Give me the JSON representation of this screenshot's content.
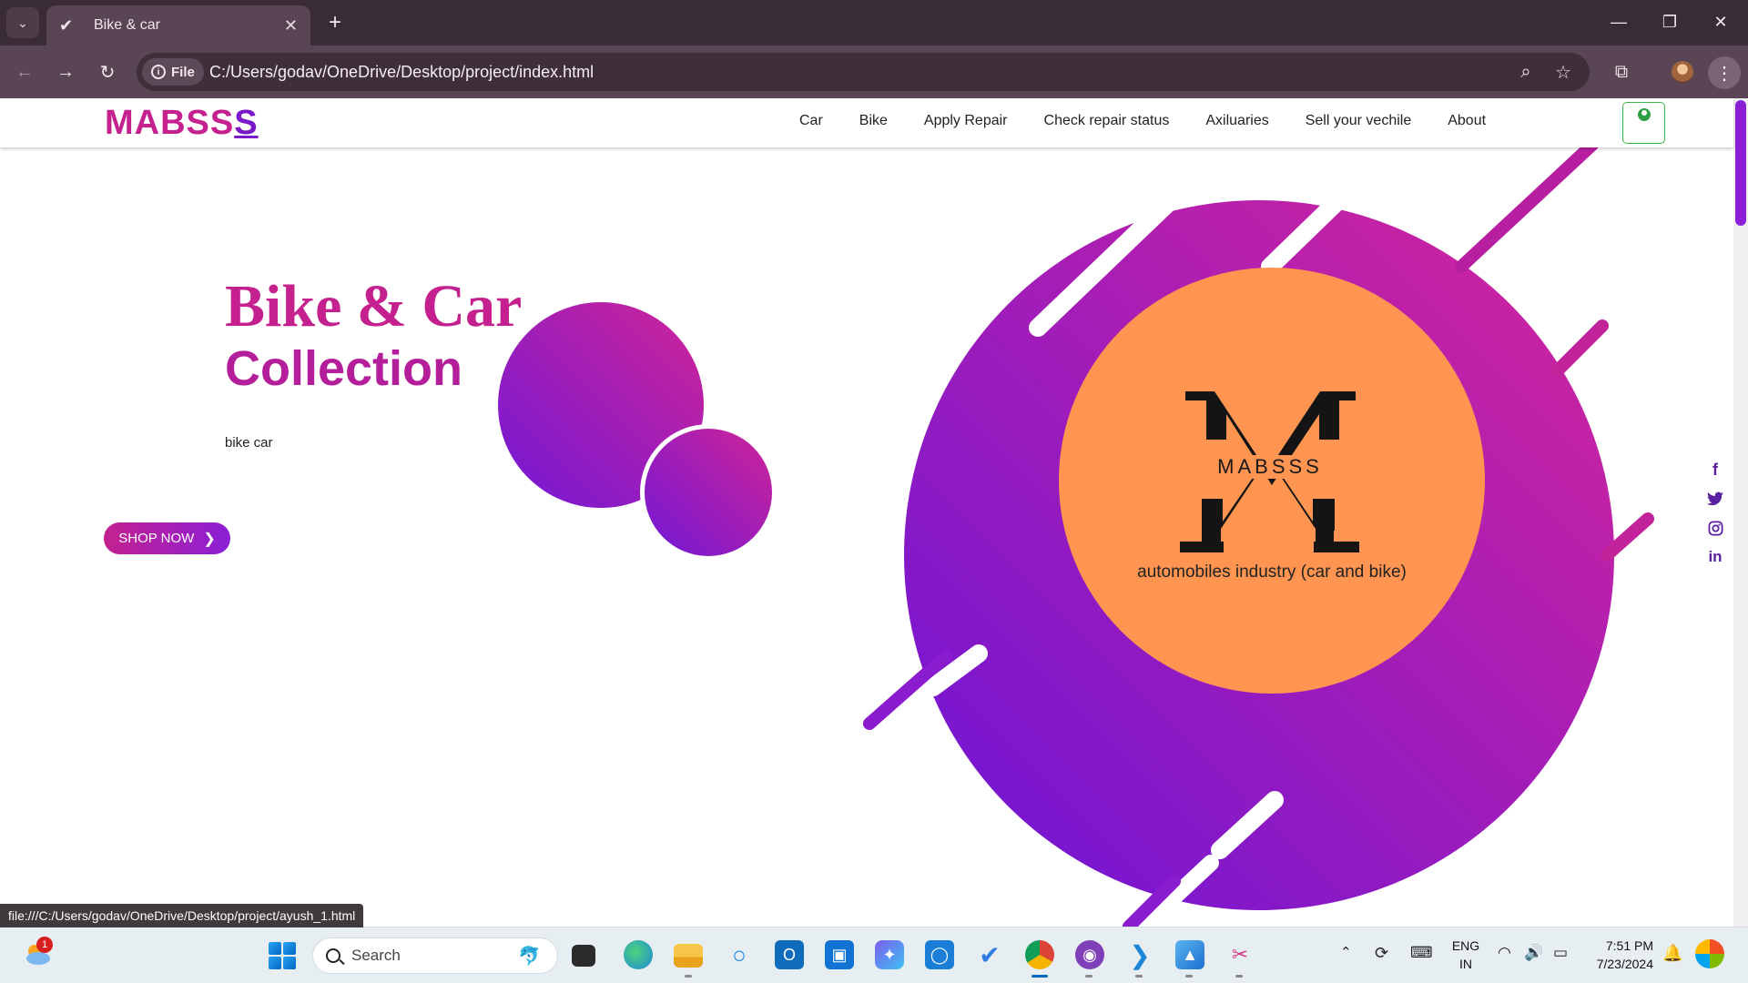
{
  "browser": {
    "tab_title": "Bike & car",
    "tab_close": "✕",
    "new_tab": "+",
    "chip_label": "File",
    "url": "C:/Users/godav/OneDrive/Desktop/project/index.html",
    "status_url": "file:///C:/Users/godav/OneDrive/Desktop/project/ayush_1.html"
  },
  "site": {
    "brand_main": "MABSS",
    "brand_last": "S",
    "nav": [
      "Car",
      "Bike",
      "Apply Repair",
      "Check repair status",
      "Axiluaries",
      "Sell your vechile",
      "About"
    ],
    "hero": {
      "title_line1": "Bike & Car",
      "title_line2": "Collection",
      "subtitle": "bike car",
      "cta": "SHOP NOW",
      "cta_icon": "chevron-right-icon"
    },
    "logo": {
      "letter": "M",
      "wordmark": "MABSSS",
      "tagline": "automobiles industry (car and bike)",
      "bg_color": "#ff9550"
    },
    "social": [
      "facebook-icon",
      "twitter-icon",
      "instagram-icon",
      "linkedin-icon"
    ],
    "colors": {
      "pink": "#c4218f",
      "purple": "#7a17c8"
    }
  },
  "taskbar": {
    "search_placeholder": "Search",
    "weather_badge": "1",
    "lang_line1": "ENG",
    "lang_line2": "IN",
    "time": "7:51 PM",
    "date": "7/23/2024"
  }
}
